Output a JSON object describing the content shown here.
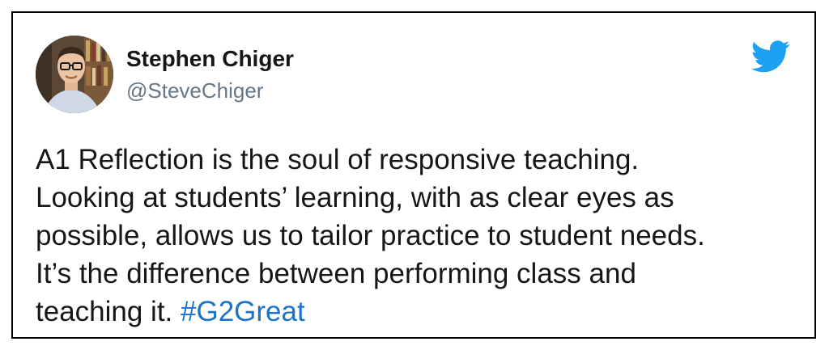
{
  "tweet": {
    "author_name": "Stephen Chiger",
    "author_handle": "@SteveChiger",
    "text_lines": [
      "A1 Reflection is the soul of responsive teaching.",
      "Looking at students’ learning, with as clear eyes as",
      "possible, allows us to tailor practice to student needs.",
      "It’s the difference between performing class and"
    ],
    "last_line_prefix": "teaching it. ",
    "hashtag": "#G2Great"
  },
  "icons": {
    "brand": "twitter-bird-icon",
    "avatar": "avatar"
  },
  "colors": {
    "brand": "#1da1f2",
    "hashtag": "#1b72c9",
    "handle": "#657786",
    "text": "#14171a"
  }
}
